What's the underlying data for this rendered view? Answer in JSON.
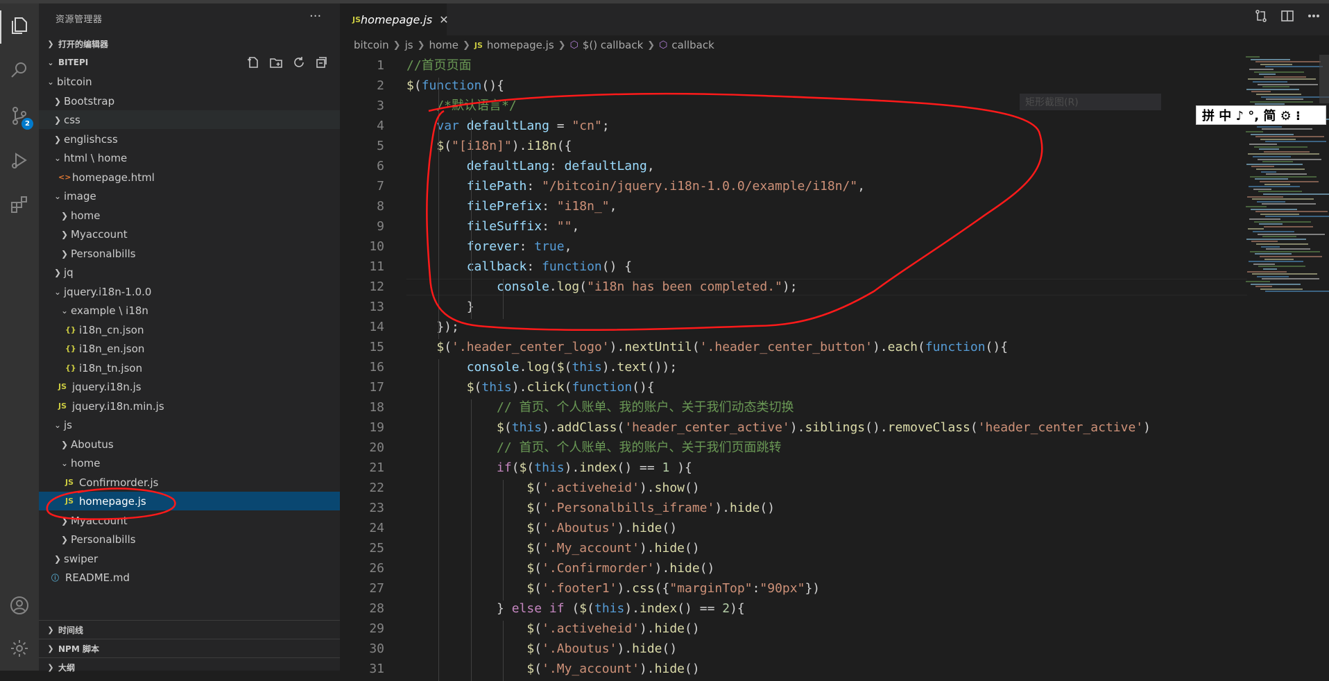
{
  "sidebar": {
    "title": "资源管理器",
    "more": "···",
    "open_editors": "打开的编辑器",
    "workspace": "BITEPI",
    "timeline": "时间线",
    "npm_scripts": "NPM 脚本",
    "outline": "大纲",
    "tree": [
      {
        "label": "bitcoin",
        "depth": 1,
        "kind": "folder",
        "open": true
      },
      {
        "label": "Bootstrap",
        "depth": 2,
        "kind": "folder",
        "open": false
      },
      {
        "label": "css",
        "depth": 2,
        "kind": "folder",
        "open": false
      },
      {
        "label": "englishcss",
        "depth": 2,
        "kind": "folder",
        "open": false
      },
      {
        "label": "html \\ home",
        "depth": 2,
        "kind": "folder",
        "open": true
      },
      {
        "label": "homepage.html",
        "depth": 3,
        "kind": "html"
      },
      {
        "label": "image",
        "depth": 2,
        "kind": "folder",
        "open": true
      },
      {
        "label": "home",
        "depth": 3,
        "kind": "folder",
        "open": false
      },
      {
        "label": "Myaccount",
        "depth": 3,
        "kind": "folder",
        "open": false
      },
      {
        "label": "Personalbills",
        "depth": 3,
        "kind": "folder",
        "open": false
      },
      {
        "label": "jq",
        "depth": 2,
        "kind": "folder",
        "open": false
      },
      {
        "label": "jquery.i18n-1.0.0",
        "depth": 2,
        "kind": "folder",
        "open": true
      },
      {
        "label": "example \\ i18n",
        "depth": 3,
        "kind": "folder",
        "open": true
      },
      {
        "label": "i18n_cn.json",
        "depth": 4,
        "kind": "json"
      },
      {
        "label": "i18n_en.json",
        "depth": 4,
        "kind": "json"
      },
      {
        "label": "i18n_tn.json",
        "depth": 4,
        "kind": "json"
      },
      {
        "label": "jquery.i18n.js",
        "depth": 3,
        "kind": "js"
      },
      {
        "label": "jquery.i18n.min.js",
        "depth": 3,
        "kind": "js"
      },
      {
        "label": "js",
        "depth": 2,
        "kind": "folder",
        "open": true
      },
      {
        "label": "Aboutus",
        "depth": 3,
        "kind": "folder",
        "open": false
      },
      {
        "label": "home",
        "depth": 3,
        "kind": "folder",
        "open": true
      },
      {
        "label": "Confirmorder.js",
        "depth": 4,
        "kind": "js"
      },
      {
        "label": "homepage.js",
        "depth": 4,
        "kind": "js",
        "selected": true
      },
      {
        "label": "Myaccount",
        "depth": 3,
        "kind": "folder",
        "open": false
      },
      {
        "label": "Personalbills",
        "depth": 3,
        "kind": "folder",
        "open": false
      },
      {
        "label": "swiper",
        "depth": 2,
        "kind": "folder",
        "open": false
      },
      {
        "label": "README.md",
        "depth": 2,
        "kind": "md"
      }
    ]
  },
  "activity": {
    "badge": "2"
  },
  "editor": {
    "tab": "homepage.js",
    "tab_icon": "JS",
    "close": "✕",
    "breadcrumb": [
      "bitcoin",
      "js",
      "home",
      "homepage.js",
      "$() callback",
      "callback"
    ]
  },
  "code_lines": [
    [
      [
        "//首页页面",
        "#6a9955"
      ]
    ],
    [
      [
        "$",
        "#dcdcaa"
      ],
      [
        "(",
        "#d4d4d4"
      ],
      [
        "function",
        "#569cd6"
      ],
      [
        "(){",
        "#d4d4d4"
      ]
    ],
    [
      [
        "    /*默认语言*/",
        "#6a9955"
      ]
    ],
    [
      [
        "    ",
        "#d4d4d4"
      ],
      [
        "var",
        "#569cd6"
      ],
      [
        " defaultLang ",
        "#9cdcfe"
      ],
      [
        "= ",
        "#d4d4d4"
      ],
      [
        "\"cn\"",
        "#ce9178"
      ],
      [
        ";",
        "#d4d4d4"
      ]
    ],
    [
      [
        "    ",
        "#d4d4d4"
      ],
      [
        "$",
        "#dcdcaa"
      ],
      [
        "(",
        "#d4d4d4"
      ],
      [
        "\"[i18n]\"",
        "#ce9178"
      ],
      [
        ").",
        "#d4d4d4"
      ],
      [
        "i18n",
        "#dcdcaa"
      ],
      [
        "({",
        "#d4d4d4"
      ]
    ],
    [
      [
        "        defaultLang",
        "#9cdcfe"
      ],
      [
        ": ",
        "#d4d4d4"
      ],
      [
        "defaultLang",
        "#9cdcfe"
      ],
      [
        ",",
        "#d4d4d4"
      ]
    ],
    [
      [
        "        filePath",
        "#9cdcfe"
      ],
      [
        ": ",
        "#d4d4d4"
      ],
      [
        "\"/bitcoin/jquery.i18n-1.0.0/example/i18n/\"",
        "#ce9178"
      ],
      [
        ",",
        "#d4d4d4"
      ]
    ],
    [
      [
        "        filePrefix",
        "#9cdcfe"
      ],
      [
        ": ",
        "#d4d4d4"
      ],
      [
        "\"i18n_\"",
        "#ce9178"
      ],
      [
        ",",
        "#d4d4d4"
      ]
    ],
    [
      [
        "        fileSuffix",
        "#9cdcfe"
      ],
      [
        ": ",
        "#d4d4d4"
      ],
      [
        "\"\"",
        "#ce9178"
      ],
      [
        ",",
        "#d4d4d4"
      ]
    ],
    [
      [
        "        forever",
        "#9cdcfe"
      ],
      [
        ": ",
        "#d4d4d4"
      ],
      [
        "true",
        "#569cd6"
      ],
      [
        ",",
        "#d4d4d4"
      ]
    ],
    [
      [
        "        callback",
        "#9cdcfe"
      ],
      [
        ": ",
        "#d4d4d4"
      ],
      [
        "function",
        "#569cd6"
      ],
      [
        "() {",
        "#d4d4d4"
      ]
    ],
    [
      [
        "            console",
        "#9cdcfe"
      ],
      [
        ".",
        "#d4d4d4"
      ],
      [
        "log",
        "#dcdcaa"
      ],
      [
        "(",
        "#d4d4d4"
      ],
      [
        "\"i18n has been completed.\"",
        "#ce9178"
      ],
      [
        ");",
        "#d4d4d4"
      ]
    ],
    [
      [
        "        }",
        "#d4d4d4"
      ]
    ],
    [
      [
        "    });",
        "#d4d4d4"
      ]
    ],
    [
      [
        "    ",
        "#d4d4d4"
      ],
      [
        "$",
        "#dcdcaa"
      ],
      [
        "(",
        "#d4d4d4"
      ],
      [
        "'.header_center_logo'",
        "#ce9178"
      ],
      [
        ").",
        "#d4d4d4"
      ],
      [
        "nextUntil",
        "#dcdcaa"
      ],
      [
        "(",
        "#d4d4d4"
      ],
      [
        "'.header_center_button'",
        "#ce9178"
      ],
      [
        ").",
        "#d4d4d4"
      ],
      [
        "each",
        "#dcdcaa"
      ],
      [
        "(",
        "#d4d4d4"
      ],
      [
        "function",
        "#569cd6"
      ],
      [
        "(){",
        "#d4d4d4"
      ]
    ],
    [
      [
        "        console",
        "#9cdcfe"
      ],
      [
        ".",
        "#d4d4d4"
      ],
      [
        "log",
        "#dcdcaa"
      ],
      [
        "(",
        "#d4d4d4"
      ],
      [
        "$",
        "#dcdcaa"
      ],
      [
        "(",
        "#d4d4d4"
      ],
      [
        "this",
        "#569cd6"
      ],
      [
        ").",
        "#d4d4d4"
      ],
      [
        "text",
        "#dcdcaa"
      ],
      [
        "());",
        "#d4d4d4"
      ]
    ],
    [
      [
        "        ",
        "#d4d4d4"
      ],
      [
        "$",
        "#dcdcaa"
      ],
      [
        "(",
        "#d4d4d4"
      ],
      [
        "this",
        "#569cd6"
      ],
      [
        ").",
        "#d4d4d4"
      ],
      [
        "click",
        "#dcdcaa"
      ],
      [
        "(",
        "#d4d4d4"
      ],
      [
        "function",
        "#569cd6"
      ],
      [
        "(){",
        "#d4d4d4"
      ]
    ],
    [
      [
        "            // 首页、个人账单、我的账户、关于我们动态类切换",
        "#6a9955"
      ]
    ],
    [
      [
        "            ",
        "#d4d4d4"
      ],
      [
        "$",
        "#dcdcaa"
      ],
      [
        "(",
        "#d4d4d4"
      ],
      [
        "this",
        "#569cd6"
      ],
      [
        ").",
        "#d4d4d4"
      ],
      [
        "addClass",
        "#dcdcaa"
      ],
      [
        "(",
        "#d4d4d4"
      ],
      [
        "'header_center_active'",
        "#ce9178"
      ],
      [
        ").",
        "#d4d4d4"
      ],
      [
        "siblings",
        "#dcdcaa"
      ],
      [
        "().",
        "#d4d4d4"
      ],
      [
        "removeClass",
        "#dcdcaa"
      ],
      [
        "(",
        "#d4d4d4"
      ],
      [
        "'header_center_active'",
        "#ce9178"
      ],
      [
        ")",
        "#d4d4d4"
      ]
    ],
    [
      [
        "            // 首页、个人账单、我的账户、关于我们页面跳转",
        "#6a9955"
      ]
    ],
    [
      [
        "            ",
        "#d4d4d4"
      ],
      [
        "if",
        "#c586c0"
      ],
      [
        "(",
        "#d4d4d4"
      ],
      [
        "$",
        "#dcdcaa"
      ],
      [
        "(",
        "#d4d4d4"
      ],
      [
        "this",
        "#569cd6"
      ],
      [
        ").",
        "#d4d4d4"
      ],
      [
        "index",
        "#dcdcaa"
      ],
      [
        "() == ",
        "#d4d4d4"
      ],
      [
        "1",
        "#b5cea8"
      ],
      [
        " ){",
        "#d4d4d4"
      ]
    ],
    [
      [
        "                ",
        "#d4d4d4"
      ],
      [
        "$",
        "#dcdcaa"
      ],
      [
        "(",
        "#d4d4d4"
      ],
      [
        "'.activeheid'",
        "#ce9178"
      ],
      [
        ").",
        "#d4d4d4"
      ],
      [
        "show",
        "#dcdcaa"
      ],
      [
        "()",
        "#d4d4d4"
      ]
    ],
    [
      [
        "                ",
        "#d4d4d4"
      ],
      [
        "$",
        "#dcdcaa"
      ],
      [
        "(",
        "#d4d4d4"
      ],
      [
        "'.Personalbills_iframe'",
        "#ce9178"
      ],
      [
        ").",
        "#d4d4d4"
      ],
      [
        "hide",
        "#dcdcaa"
      ],
      [
        "()",
        "#d4d4d4"
      ]
    ],
    [
      [
        "                ",
        "#d4d4d4"
      ],
      [
        "$",
        "#dcdcaa"
      ],
      [
        "(",
        "#d4d4d4"
      ],
      [
        "'.Aboutus'",
        "#ce9178"
      ],
      [
        ").",
        "#d4d4d4"
      ],
      [
        "hide",
        "#dcdcaa"
      ],
      [
        "()",
        "#d4d4d4"
      ]
    ],
    [
      [
        "                ",
        "#d4d4d4"
      ],
      [
        "$",
        "#dcdcaa"
      ],
      [
        "(",
        "#d4d4d4"
      ],
      [
        "'.My_account'",
        "#ce9178"
      ],
      [
        ").",
        "#d4d4d4"
      ],
      [
        "hide",
        "#dcdcaa"
      ],
      [
        "()",
        "#d4d4d4"
      ]
    ],
    [
      [
        "                ",
        "#d4d4d4"
      ],
      [
        "$",
        "#dcdcaa"
      ],
      [
        "(",
        "#d4d4d4"
      ],
      [
        "'.Confirmorder'",
        "#ce9178"
      ],
      [
        ").",
        "#d4d4d4"
      ],
      [
        "hide",
        "#dcdcaa"
      ],
      [
        "()",
        "#d4d4d4"
      ]
    ],
    [
      [
        "                ",
        "#d4d4d4"
      ],
      [
        "$",
        "#dcdcaa"
      ],
      [
        "(",
        "#d4d4d4"
      ],
      [
        "'.footer1'",
        "#ce9178"
      ],
      [
        ").",
        "#d4d4d4"
      ],
      [
        "css",
        "#dcdcaa"
      ],
      [
        "({",
        "#d4d4d4"
      ],
      [
        "\"marginTop\"",
        "#ce9178"
      ],
      [
        ":",
        "#d4d4d4"
      ],
      [
        "\"90px\"",
        "#ce9178"
      ],
      [
        "})",
        "#d4d4d4"
      ]
    ],
    [
      [
        "            } ",
        "#d4d4d4"
      ],
      [
        "else",
        "#c586c0"
      ],
      [
        " ",
        "#d4d4d4"
      ],
      [
        "if",
        "#c586c0"
      ],
      [
        " (",
        "#d4d4d4"
      ],
      [
        "$",
        "#dcdcaa"
      ],
      [
        "(",
        "#d4d4d4"
      ],
      [
        "this",
        "#569cd6"
      ],
      [
        ").",
        "#d4d4d4"
      ],
      [
        "index",
        "#dcdcaa"
      ],
      [
        "() == ",
        "#d4d4d4"
      ],
      [
        "2",
        "#b5cea8"
      ],
      [
        "){",
        "#d4d4d4"
      ]
    ],
    [
      [
        "                ",
        "#d4d4d4"
      ],
      [
        "$",
        "#dcdcaa"
      ],
      [
        "(",
        "#d4d4d4"
      ],
      [
        "'.activeheid'",
        "#ce9178"
      ],
      [
        ").",
        "#d4d4d4"
      ],
      [
        "hide",
        "#dcdcaa"
      ],
      [
        "()",
        "#d4d4d4"
      ]
    ],
    [
      [
        "                ",
        "#d4d4d4"
      ],
      [
        "$",
        "#dcdcaa"
      ],
      [
        "(",
        "#d4d4d4"
      ],
      [
        "'.Aboutus'",
        "#ce9178"
      ],
      [
        ").",
        "#d4d4d4"
      ],
      [
        "hide",
        "#dcdcaa"
      ],
      [
        "()",
        "#d4d4d4"
      ]
    ],
    [
      [
        "                ",
        "#d4d4d4"
      ],
      [
        "$",
        "#dcdcaa"
      ],
      [
        "(",
        "#d4d4d4"
      ],
      [
        "'.My_account'",
        "#ce9178"
      ],
      [
        ").",
        "#d4d4d4"
      ],
      [
        "hide",
        "#dcdcaa"
      ],
      [
        "()",
        "#d4d4d4"
      ]
    ]
  ],
  "overlays": {
    "ime_toolbar": "拼 中 ♪ °, 简 ⚙ ⁝",
    "tooltip": "矩形截图(R)"
  },
  "colors": {
    "annotation": "#ff1a1a",
    "selection": "#094771",
    "accent": "#007acc"
  }
}
